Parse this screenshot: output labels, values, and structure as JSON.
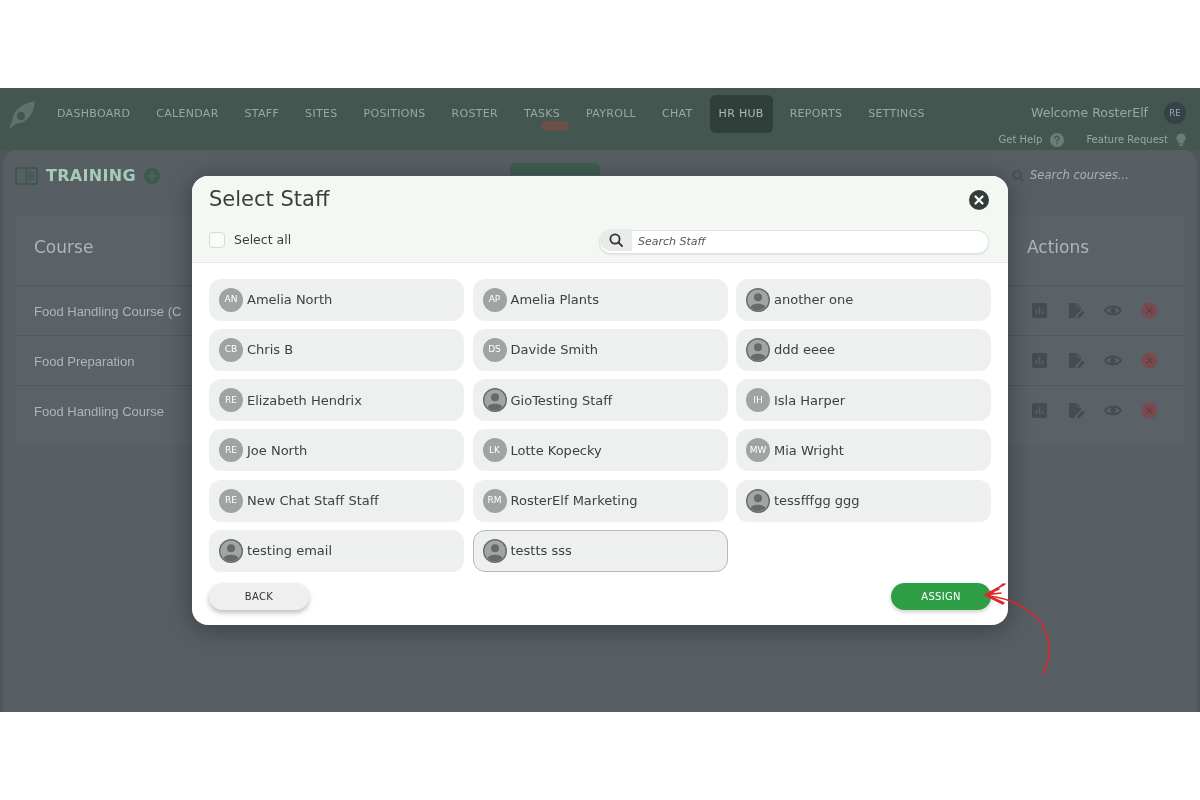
{
  "navbar": {
    "items": [
      {
        "label": "DASHBOARD",
        "selected": false,
        "badge": false
      },
      {
        "label": "CALENDAR",
        "selected": false,
        "badge": false
      },
      {
        "label": "STAFF",
        "selected": false,
        "badge": false
      },
      {
        "label": "SITES",
        "selected": false,
        "badge": false
      },
      {
        "label": "POSITIONS",
        "selected": false,
        "badge": false
      },
      {
        "label": "ROSTER",
        "selected": false,
        "badge": false
      },
      {
        "label": "TASKS",
        "selected": false,
        "badge": true
      },
      {
        "label": "PAYROLL",
        "selected": false,
        "badge": false
      },
      {
        "label": "CHAT",
        "selected": false,
        "badge": false
      },
      {
        "label": "HR HUB",
        "selected": true,
        "badge": false
      },
      {
        "label": "REPORTS",
        "selected": false,
        "badge": false
      },
      {
        "label": "SETTINGS",
        "selected": false,
        "badge": false
      }
    ],
    "welcome": "Welcome RosterElf",
    "avatar": "RE",
    "links": [
      {
        "label": "Get Help",
        "kind": "help"
      },
      {
        "label": "Feature Request",
        "kind": "idea"
      }
    ]
  },
  "page": {
    "title": "TRAINING",
    "search": {
      "placeholder": "Search courses..."
    },
    "table": {
      "columns": [
        "Course",
        "Actions"
      ],
      "rows": [
        {
          "course": "Food Handling Course (C"
        },
        {
          "course": "Food Preparation"
        },
        {
          "course": "Food Handling Course"
        }
      ]
    }
  },
  "modal": {
    "title": "Select Staff",
    "select_all": {
      "label": "Select all",
      "checked": false
    },
    "search": {
      "placeholder": "Search Staff"
    },
    "staff": [
      {
        "name": "Amelia North",
        "kind": "initials",
        "initials": "AN",
        "selected": false
      },
      {
        "name": "Amelia Plants",
        "kind": "initials",
        "initials": "AP",
        "selected": false
      },
      {
        "name": "another one",
        "kind": "silhouette",
        "selected": false
      },
      {
        "name": "Chris B",
        "kind": "initials",
        "initials": "CB",
        "selected": false
      },
      {
        "name": "Davide Smith",
        "kind": "initials",
        "initials": "DS",
        "selected": false
      },
      {
        "name": "ddd eeee",
        "kind": "silhouette",
        "selected": false
      },
      {
        "name": "Elizabeth Hendrix",
        "kind": "initials",
        "initials": "RE",
        "selected": false
      },
      {
        "name": "GioTesting Staff",
        "kind": "silhouette",
        "selected": false
      },
      {
        "name": "Isla Harper",
        "kind": "initials",
        "initials": "IH",
        "selected": false
      },
      {
        "name": "Joe North",
        "kind": "initials",
        "initials": "RE",
        "selected": false
      },
      {
        "name": "Lotte Kopecky",
        "kind": "initials",
        "initials": "LK",
        "selected": false
      },
      {
        "name": "Mia Wright",
        "kind": "initials",
        "initials": "MW",
        "selected": false
      },
      {
        "name": "New Chat Staff Staff",
        "kind": "initials",
        "initials": "RE",
        "selected": false
      },
      {
        "name": "RosterElf Marketing",
        "kind": "initials",
        "initials": "RM",
        "selected": false
      },
      {
        "name": "tessfffgg ggg",
        "kind": "silhouette",
        "selected": false
      },
      {
        "name": "testing email",
        "kind": "silhouette",
        "selected": false
      },
      {
        "name": "testts sss",
        "kind": "silhouette",
        "selected": true
      }
    ],
    "buttons": [
      {
        "label": "BACK",
        "kind": "secondary"
      },
      {
        "label": "ASSIGN",
        "kind": "primary"
      }
    ]
  }
}
